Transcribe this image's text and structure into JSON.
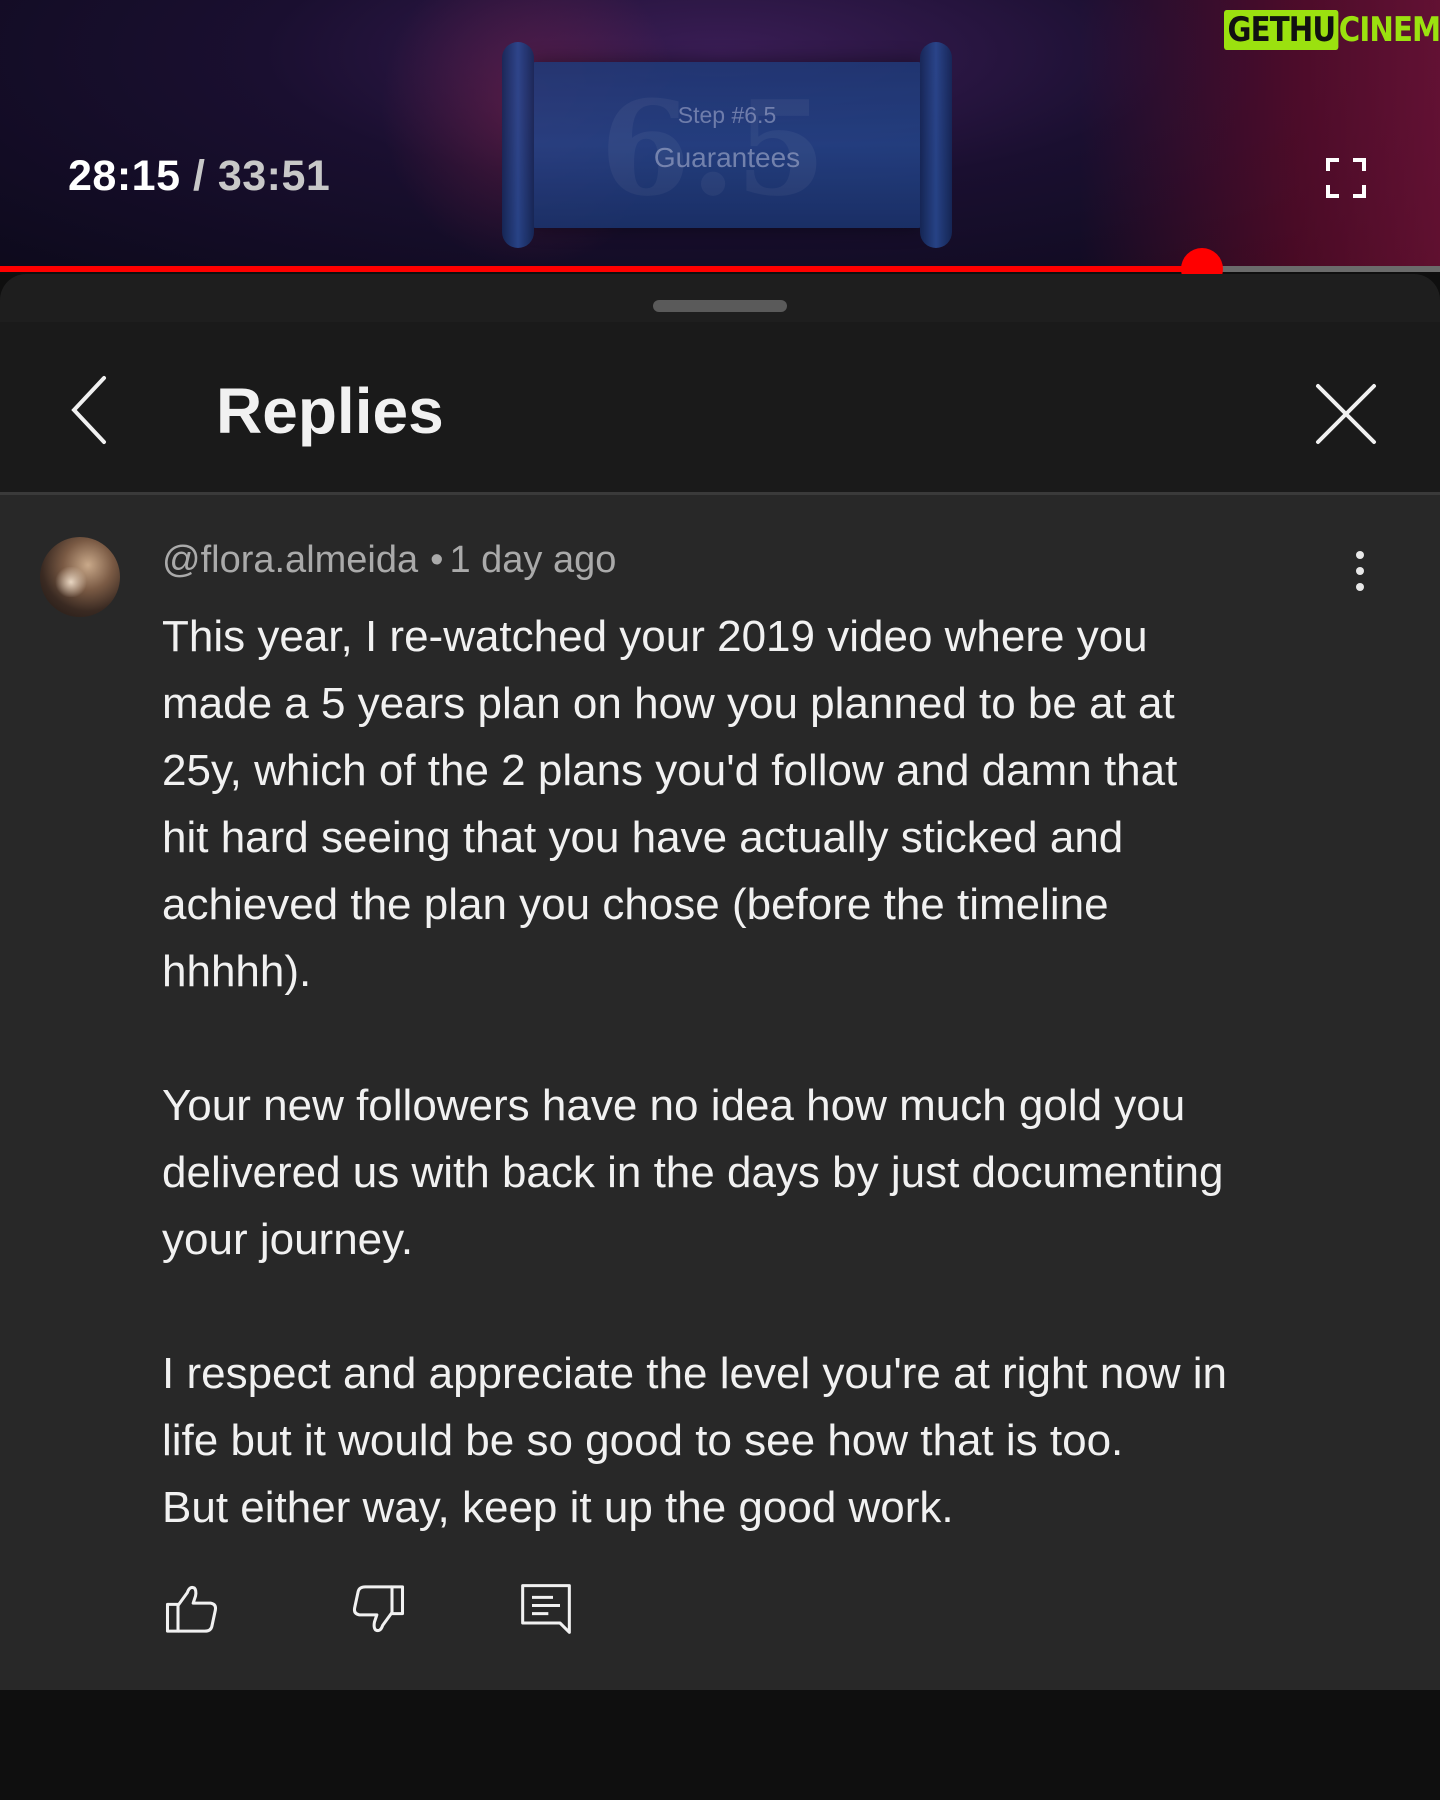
{
  "player": {
    "current_time": "28:15",
    "separator": "/",
    "duration": "33:51",
    "progress": 0.835,
    "slide_step": "Step #6.5",
    "slide_title": "Guarantees",
    "slide_big_number": "6.5",
    "watermark_part1": "GETHU",
    "watermark_part2": "CINEMA",
    "accent_color": "#ff0000"
  },
  "header": {
    "title": "Replies",
    "back_icon": "chevron-left-icon",
    "close_icon": "close-icon"
  },
  "comment": {
    "author": "@flora.almeida",
    "dot": "•",
    "time": "1 day ago",
    "paragraphs": [
      "This year, I re-watched your 2019 video where you\nmade a 5 years plan on how you planned to be at at\n25y, which of the 2 plans you'd follow and damn that\nhit hard seeing that you have actually sticked and\nachieved the plan you chose (before the timeline\nhhhhh).",
      "Your new followers have no idea how much gold you\ndelivered us with back in the days by just documenting\nyour journey.",
      "I respect and appreciate the level you're at right now in\nlife but it would be so good to see how that is too.\nBut either way, keep it up the good work."
    ],
    "actions": [
      "like-icon",
      "dislike-icon",
      "reply-icon"
    ]
  }
}
